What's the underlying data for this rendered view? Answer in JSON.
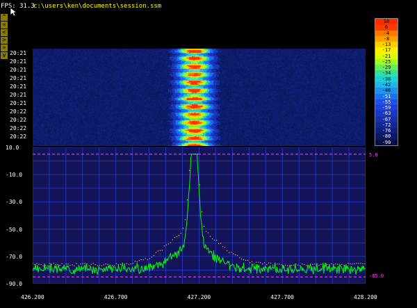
{
  "header": {
    "fps": "FPS: 31.3",
    "file_path": "c:\\users\\ken\\documents\\session.ssm"
  },
  "nav_buttons": [
    {
      "glyph": "^",
      "icon": "up-icon"
    },
    {
      "glyph": "«",
      "icon": "double-left-icon"
    },
    {
      "glyph": "<",
      "icon": "left-icon"
    },
    {
      "glyph": ">",
      "icon": "right-icon"
    },
    {
      "glyph": "»",
      "icon": "double-right-icon"
    },
    {
      "glyph": "v",
      "icon": "down-icon"
    }
  ],
  "waterfall": {
    "timestamps": [
      "20:21",
      "20:21",
      "20:21",
      "20:21",
      "20:21",
      "20:21",
      "20:21",
      "20:22",
      "20:22",
      "20:22",
      "20:22"
    ]
  },
  "legend": {
    "values": [
      "10",
      "6",
      "-4",
      "-8",
      "-13",
      "-17",
      "-21",
      "-25",
      "-29",
      "-34",
      "-38",
      "-42",
      "-46",
      "-51",
      "-55",
      "-59",
      "-63",
      "-67",
      "-72",
      "-76",
      "-80",
      "-90"
    ],
    "colors": [
      "#ff2a00",
      "#ff3c00",
      "#ff7800",
      "#ffa000",
      "#ffd000",
      "#fff000",
      "#d8ff00",
      "#a0ff20",
      "#60f060",
      "#30e0a0",
      "#20d0d0",
      "#20b8e8",
      "#2090f0",
      "#2070f0",
      "#2050e8",
      "#2040d8",
      "#1838c0",
      "#1830a8",
      "#102890",
      "#102078",
      "#0c1860",
      "#081040"
    ]
  },
  "spectrum": {
    "y_labels": [
      "10.0",
      "-10.0",
      "-30.0",
      "-50.0",
      "-70.0",
      "-90.0"
    ],
    "x_labels": [
      "426.200",
      "426.700",
      "427.200",
      "427.700",
      "428.200"
    ],
    "ref_top": "5.0",
    "ref_bottom": "-85.0",
    "ylim": [
      -90,
      10
    ],
    "xlim": [
      426.2,
      428.2
    ],
    "colors": {
      "grid": "#2a3fd8",
      "trace": "#00ff00",
      "dots": "#ffaa55",
      "ref": "#ff44ff",
      "background": "#14145a"
    }
  }
}
